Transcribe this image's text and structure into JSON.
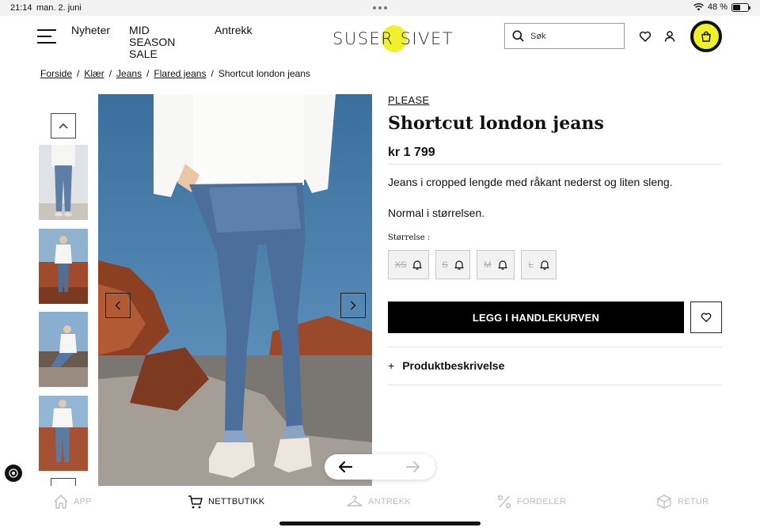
{
  "status_bar": {
    "time": "21:14",
    "date": "man. 2. juni",
    "battery": "48 %",
    "battery_level": 0.48
  },
  "header": {
    "nav": [
      "Nyheter",
      "MID SEASON SALE",
      "Antrekk"
    ],
    "logo_text": "SUSER SIVET",
    "search_placeholder": "Søk",
    "icons": [
      "menu-icon",
      "search-icon",
      "heart-icon",
      "user-icon",
      "cart-icon"
    ],
    "accent_color": "#f0f02c"
  },
  "breadcrumb": [
    "Forside",
    "Klær",
    "Jeans",
    "Flared jeans",
    "Shortcut london jeans"
  ],
  "product": {
    "brand": "PLEASE",
    "title": "Shortcut london jeans",
    "price": "kr 1 799",
    "description": "Jeans i cropped lengde med råkant nederst og liten sleng.",
    "fit_note": "Normal i størrelsen.",
    "size_label": "Størrelse :",
    "sizes": [
      {
        "label": "XS",
        "available": false
      },
      {
        "label": "S",
        "available": false
      },
      {
        "label": "M",
        "available": false
      },
      {
        "label": "L",
        "available": false
      }
    ],
    "add_to_cart": "LEGG I HANDLEKURVEN",
    "accordion_label": "Produktbeskrivelse",
    "accordion_symbol": "+"
  },
  "bottom_tabs": [
    {
      "label": "APP",
      "icon": "home-icon",
      "active": false
    },
    {
      "label": "NETTBUTIKK",
      "icon": "cart-icon",
      "active": true
    },
    {
      "label": "ANTREKK",
      "icon": "hanger-icon",
      "active": false
    },
    {
      "label": "FORDELER",
      "icon": "percent-icon",
      "active": false
    },
    {
      "label": "RETUR",
      "icon": "return-icon",
      "active": false
    }
  ]
}
